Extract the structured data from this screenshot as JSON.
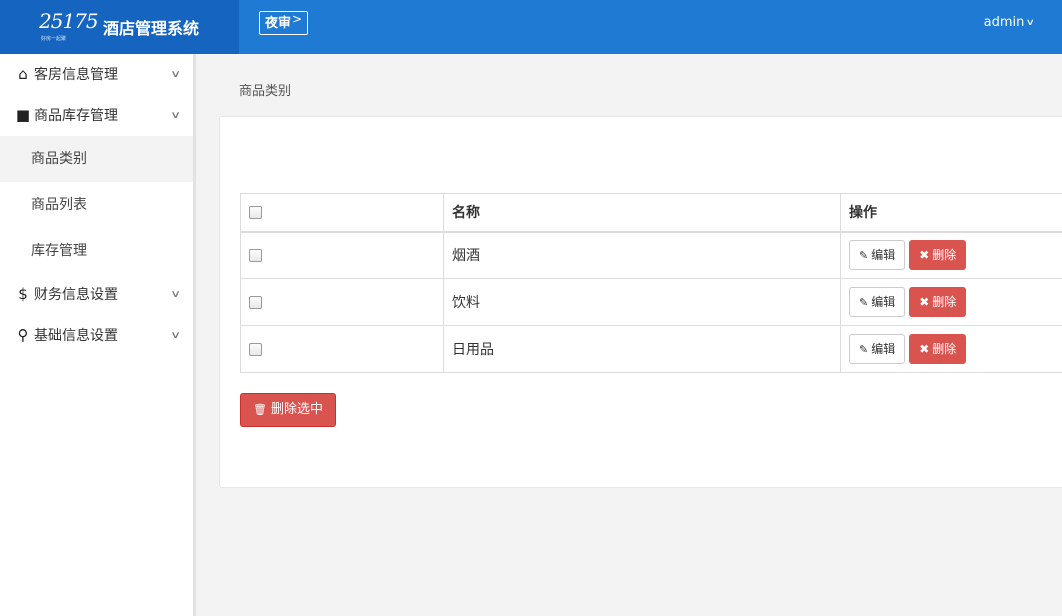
{
  "header": {
    "logo_text": "25175",
    "logo_sub": "好房一起聚",
    "title": "酒店管理系统",
    "night_audit_label": "夜审",
    "night_audit_chevron": ">",
    "user_name": "admin",
    "user_caret": "∨"
  },
  "sidebar": {
    "items": [
      {
        "icon": "home-icon",
        "glyph": "⌂",
        "label": "客房信息管理",
        "chevron": "∨"
      },
      {
        "icon": "bag-icon",
        "glyph": "■",
        "label": "商品库存管理",
        "chevron": "∨",
        "children": [
          {
            "label": "商品类别",
            "active": true
          },
          {
            "label": "商品列表"
          },
          {
            "label": "库存管理"
          }
        ]
      },
      {
        "icon": "dollar-icon",
        "glyph": "$",
        "label": "财务信息设置",
        "chevron": "∨"
      },
      {
        "icon": "link-icon",
        "glyph": "⚲",
        "label": "基础信息设置",
        "chevron": "∨"
      }
    ]
  },
  "breadcrumb": "商品类别",
  "table": {
    "headers": [
      "",
      "名称",
      "操作"
    ],
    "rows": [
      {
        "name": "烟酒"
      },
      {
        "name": "饮料"
      },
      {
        "name": "日用品"
      }
    ],
    "edit_label": "编辑",
    "edit_glyph": "✎",
    "delete_label": "删除",
    "delete_glyph": "✖"
  },
  "bulk_delete": {
    "label": "删除选中",
    "glyph": "🗑"
  },
  "colors": {
    "topbar": "#1e7ad3",
    "brand": "#1464c0",
    "danger": "#d9534f"
  }
}
